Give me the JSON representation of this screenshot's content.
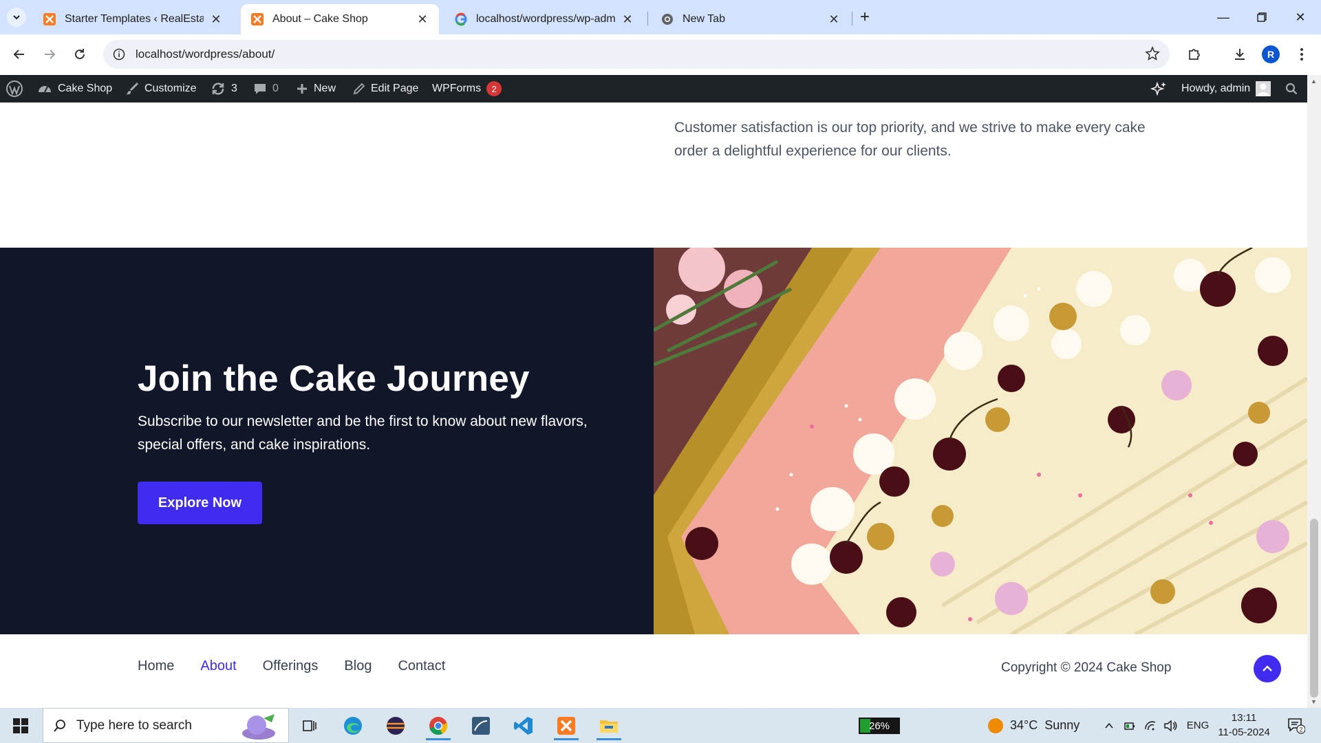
{
  "browser": {
    "tabs": [
      {
        "title": "Starter Templates ‹ RealEstate-B",
        "favicon": "xampp-icon",
        "active": false
      },
      {
        "title": "About – Cake Shop",
        "favicon": "xampp-icon",
        "active": true
      },
      {
        "title": "localhost/wordpress/wp-admin",
        "favicon": "google-icon",
        "active": false
      },
      {
        "title": "New Tab",
        "favicon": "chrome-icon",
        "active": false
      }
    ],
    "url": "localhost/wordpress/about/",
    "profile_initial": "R"
  },
  "wp_admin_bar": {
    "site_name": "Cake Shop",
    "customize": "Customize",
    "updates_count": "3",
    "comments_count": "0",
    "new": "New",
    "edit_page": "Edit Page",
    "wpforms": "WPForms",
    "wpforms_badge": "2",
    "howdy": "Howdy, admin"
  },
  "page": {
    "about_paragraph": "Customer satisfaction is our top priority, and we strive to make every cake order a delightful experience for our clients.",
    "cta": {
      "title": "Join the Cake Journey",
      "subtitle": "Subscribe to our newsletter and be the first to know about new flavors, special offers, and cake inspirations.",
      "button": "Explore Now"
    },
    "footer": {
      "nav": [
        {
          "label": "Home",
          "current": false
        },
        {
          "label": "About",
          "current": true
        },
        {
          "label": "Offerings",
          "current": false
        },
        {
          "label": "Blog",
          "current": false
        },
        {
          "label": "Contact",
          "current": false
        }
      ],
      "copyright": "Copyright © 2024 Cake Shop"
    }
  },
  "taskbar": {
    "search_placeholder": "Type here to search",
    "battery_percent": "26%",
    "battery_level": 0.26,
    "weather_temp": "34°C",
    "weather_text": "Sunny",
    "language": "ENG",
    "time": "13:11",
    "date": "11-05-2024",
    "notification_count": "2"
  },
  "colors": {
    "accent": "#3f2cf0",
    "cta_background": "#111629",
    "wp_admin_bar": "#1d2327",
    "tab_strip": "#d3e3fd"
  }
}
